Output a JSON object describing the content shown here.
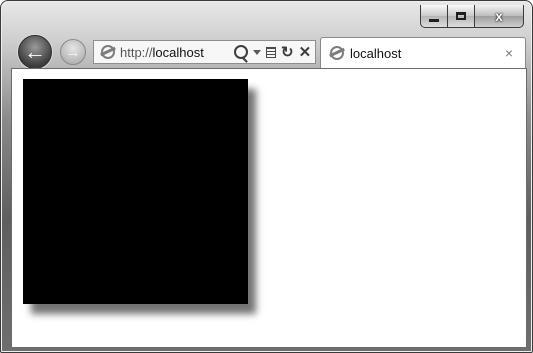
{
  "window": {
    "caption_buttons": [
      {
        "name": "minimize",
        "icon": "minimize-icon"
      },
      {
        "name": "maximize",
        "icon": "maximize-icon"
      },
      {
        "name": "close",
        "icon": "close-icon",
        "glyph": "x"
      }
    ]
  },
  "nav": {
    "back_glyph": "←",
    "forward_glyph": "→"
  },
  "address_bar": {
    "url_prefix": "http://",
    "url_host": "localhost",
    "icons": [
      "ie-page-icon",
      "search-icon",
      "dropdown-icon",
      "compatibility-view-icon",
      "refresh-icon",
      "stop-icon"
    ],
    "refresh_glyph": "↻",
    "stop_glyph": "✕"
  },
  "tab": {
    "label": "localhost",
    "close_glyph": "×"
  },
  "content": {
    "box_color": "#000000"
  }
}
